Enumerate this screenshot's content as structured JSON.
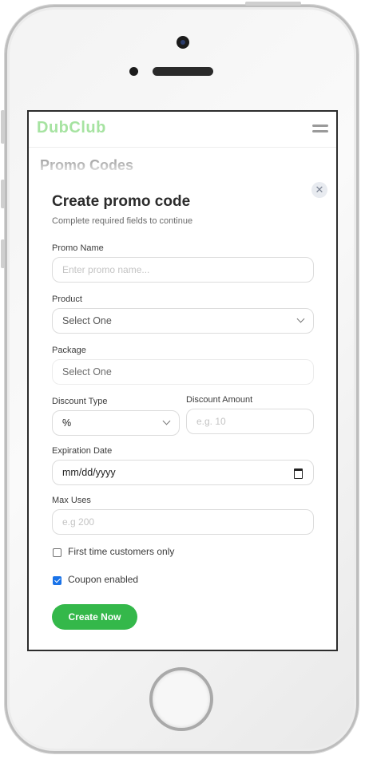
{
  "app": {
    "logo": "DubClub",
    "page_title": "Promo Codes"
  },
  "modal": {
    "title": "Create promo code",
    "subtitle": "Complete required fields to continue",
    "fields": {
      "promo_name": {
        "label": "Promo Name",
        "placeholder": "Enter promo name..."
      },
      "product": {
        "label": "Product",
        "value": "Select One"
      },
      "package": {
        "label": "Package",
        "value": "Select One"
      },
      "discount_type": {
        "label": "Discount Type",
        "value": "%"
      },
      "discount_amount": {
        "label": "Discount Amount",
        "placeholder": "e.g. 10"
      },
      "expiration_date": {
        "label": "Expiration Date",
        "value": "mm/dd/yyyy"
      },
      "max_uses": {
        "label": "Max Uses",
        "placeholder": "e.g 200"
      }
    },
    "checkboxes": {
      "first_time": {
        "label": "First time customers only",
        "checked": false
      },
      "coupon_enabled": {
        "label": "Coupon enabled",
        "checked": true
      }
    },
    "submit_label": "Create Now",
    "close_symbol": "✕"
  },
  "colors": {
    "brand": "#a6e3a1",
    "primary_button": "#34b84a",
    "checkbox_on": "#1a73e8"
  }
}
